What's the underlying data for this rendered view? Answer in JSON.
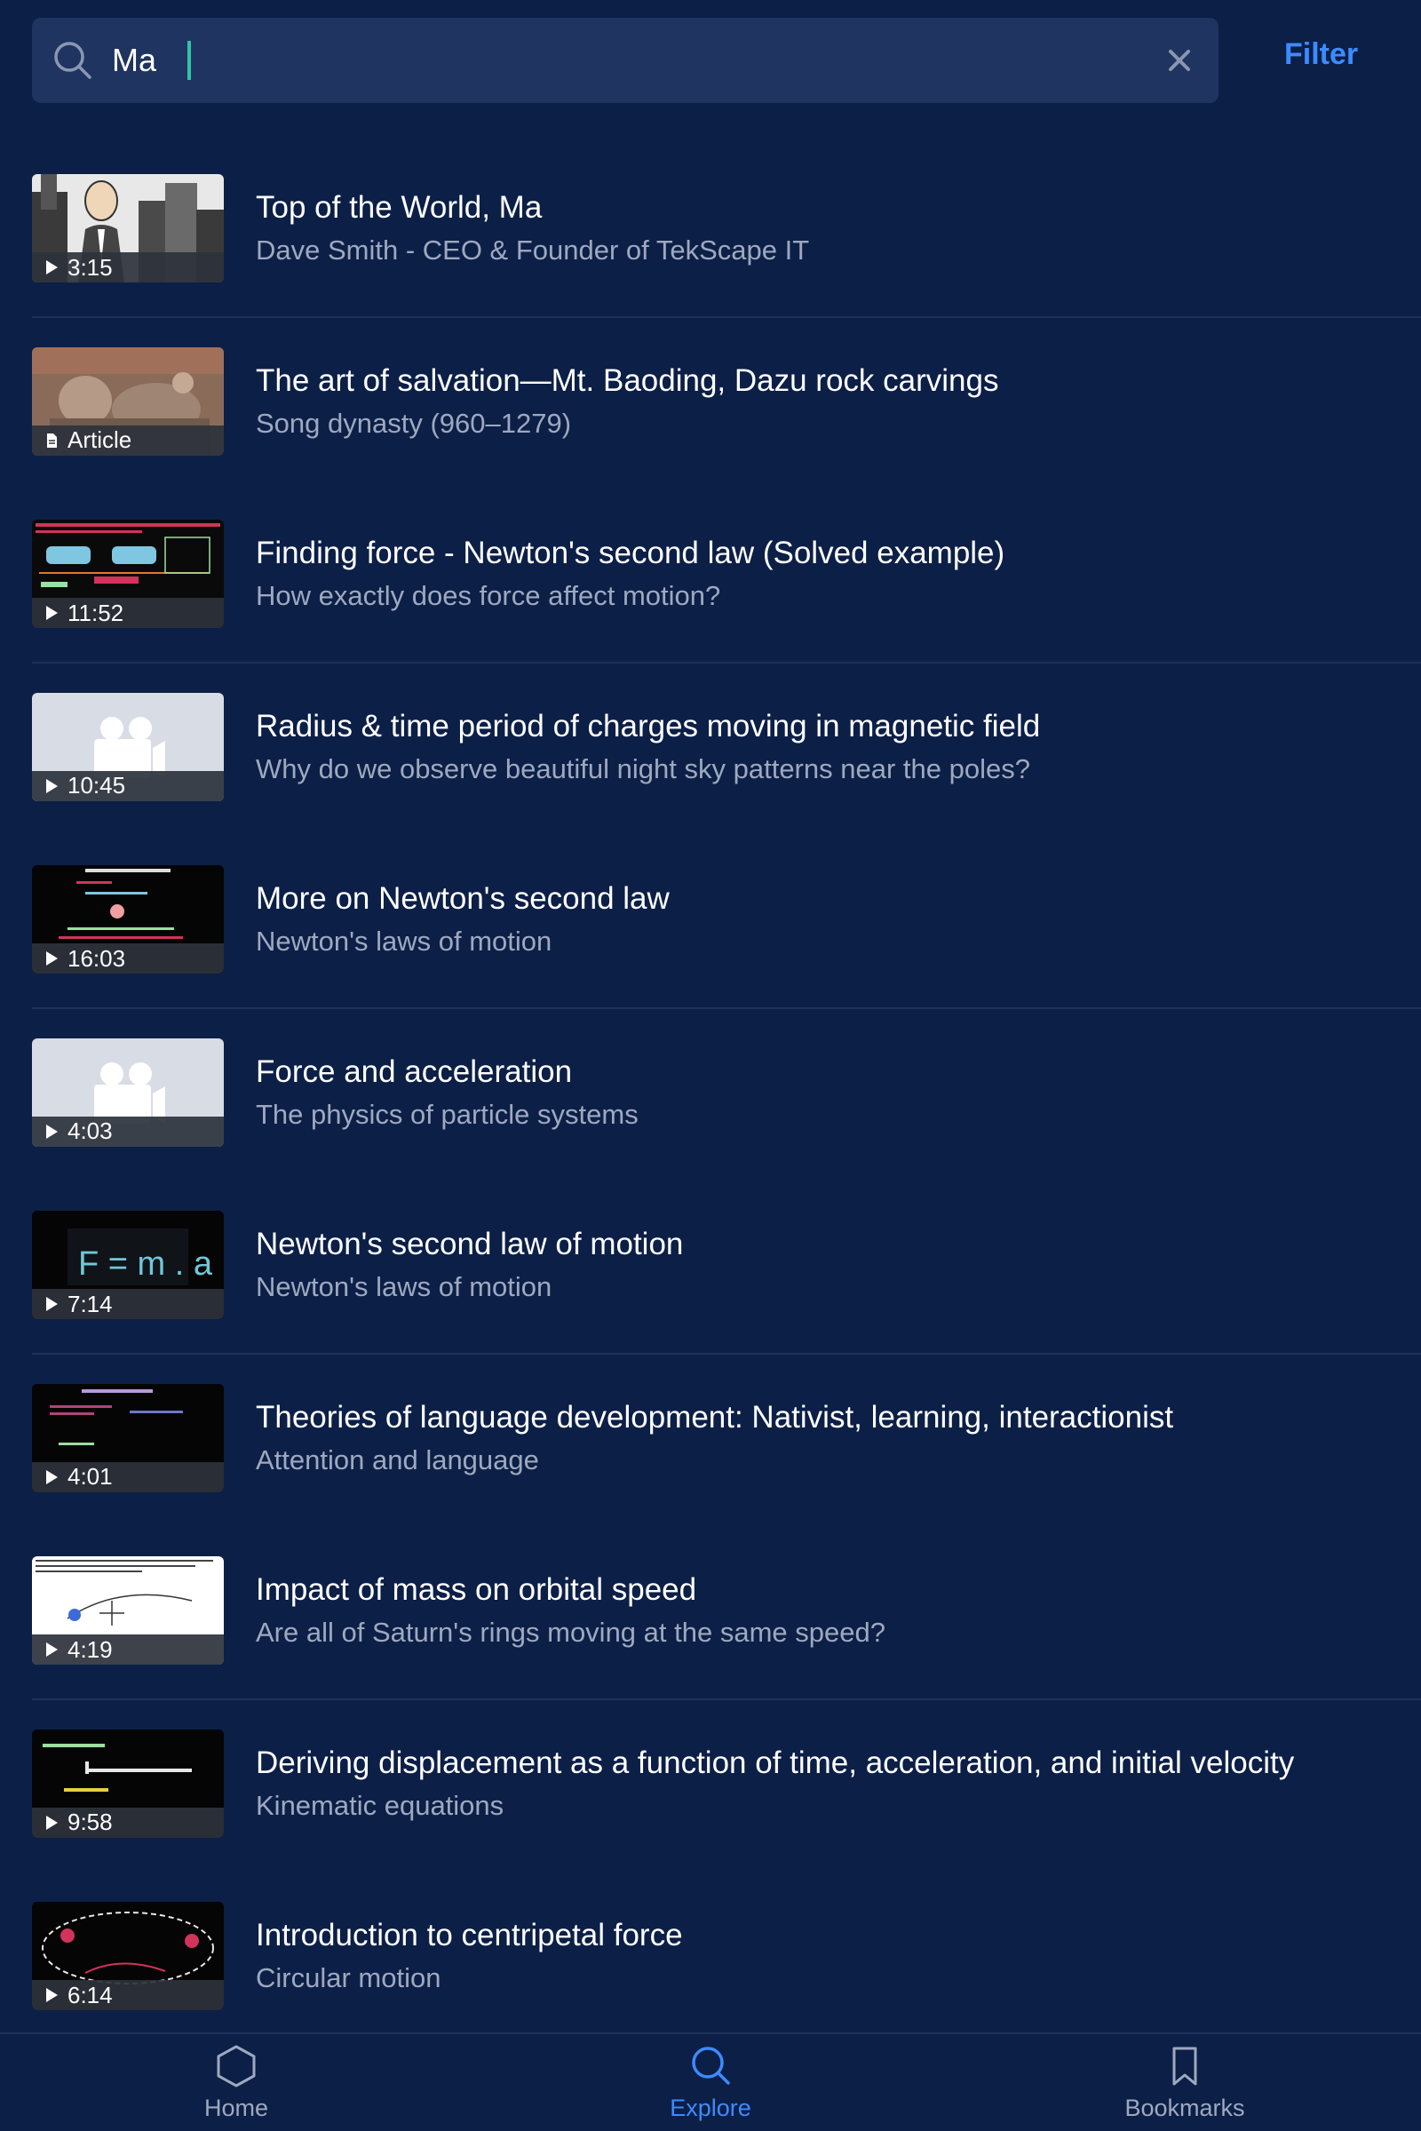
{
  "search": {
    "value": "Ma",
    "placeholder": ""
  },
  "filter_label": "Filter",
  "results": [
    {
      "title": "Top of the World, Ma",
      "subtitle": "Dave Smith - CEO & Founder of TekScape IT",
      "badge": "3:15",
      "kind": "video"
    },
    {
      "title": "The art of salvation—Mt. Baoding, Dazu rock carvings",
      "subtitle": "Song dynasty (960–1279)",
      "badge": "Article",
      "kind": "article"
    },
    {
      "title": "Finding force - Newton's second law (Solved example)",
      "subtitle": "How exactly does force affect motion?",
      "badge": "11:52",
      "kind": "video"
    },
    {
      "title": "Radius & time period of charges moving in magnetic field",
      "subtitle": "Why do we observe beautiful night sky patterns near the poles?",
      "badge": "10:45",
      "kind": "video"
    },
    {
      "title": "More on Newton's second law",
      "subtitle": "Newton's laws of motion",
      "badge": "16:03",
      "kind": "video"
    },
    {
      "title": "Force and acceleration",
      "subtitle": "The physics of particle systems",
      "badge": "4:03",
      "kind": "video"
    },
    {
      "title": "Newton's second law of motion",
      "subtitle": "Newton's laws of motion",
      "badge": "7:14",
      "kind": "video"
    },
    {
      "title": "Theories of language development: Nativist, learning, interactionist",
      "subtitle": "Attention and language",
      "badge": "4:01",
      "kind": "video"
    },
    {
      "title": "Impact of mass on orbital speed",
      "subtitle": "Are all of Saturn's rings moving at the same speed?",
      "badge": "4:19",
      "kind": "video"
    },
    {
      "title": "Deriving displacement as a function of time, acceleration, and initial velocity",
      "subtitle": "Kinematic equations",
      "badge": "9:58",
      "kind": "video"
    },
    {
      "title": "Introduction to centripetal force",
      "subtitle": "Circular motion",
      "badge": "6:14",
      "kind": "video"
    }
  ],
  "thumb_text": {
    "f_ma": "F = m . a"
  },
  "nav": [
    {
      "label": "Home",
      "icon": "hexagon-icon",
      "active": false
    },
    {
      "label": "Explore",
      "icon": "search-icon",
      "active": true
    },
    {
      "label": "Bookmarks",
      "icon": "bookmark-icon",
      "active": false
    }
  ],
  "colors": {
    "background": "#0c1f47",
    "search_box": "#1f3461",
    "accent": "#3d8bff",
    "caret": "#2ec4a6",
    "subtitle": "#9ea9bf"
  }
}
